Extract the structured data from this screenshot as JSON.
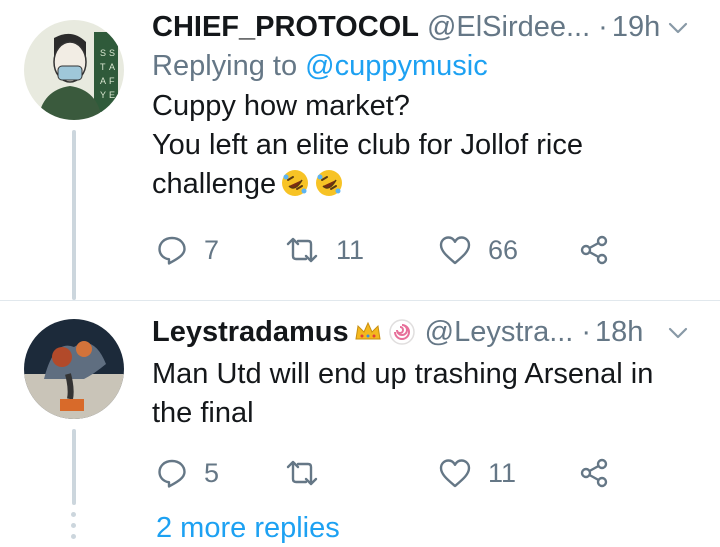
{
  "tweets": [
    {
      "name": "CHIEF_PROTOCOL",
      "handle": "@ElSirdee...",
      "dot": "·",
      "time": "19h",
      "replying_label": "Replying to",
      "replying_to": "@cuppymusic",
      "lines": [
        "Cuppy how market?",
        "You left an elite club for Jollof rice",
        "challenge"
      ],
      "emoji": [
        "rolling-laughing-emoji",
        "rolling-laughing-emoji"
      ],
      "reply_count": "7",
      "retweet_count": "11",
      "like_count": "66"
    },
    {
      "name": "Leystradamus",
      "badges": [
        "crown-emoji",
        "fish-cake-emoji"
      ],
      "handle": "@Leystra...",
      "dot": "·",
      "time": "18h",
      "lines": [
        "Man Utd will end up trashing Arsenal in",
        "the final"
      ],
      "reply_count": "5",
      "retweet_count": "",
      "like_count": "11"
    }
  ],
  "more_replies": "2 more replies",
  "colors": {
    "text": "#14171a",
    "secondary": "#657786",
    "link": "#1da1f2",
    "divider": "#e1e8ed",
    "thread": "#ccd6dd"
  },
  "icons": [
    "reply-icon",
    "retweet-icon",
    "like-icon",
    "share-icon",
    "chevron-down-icon"
  ]
}
